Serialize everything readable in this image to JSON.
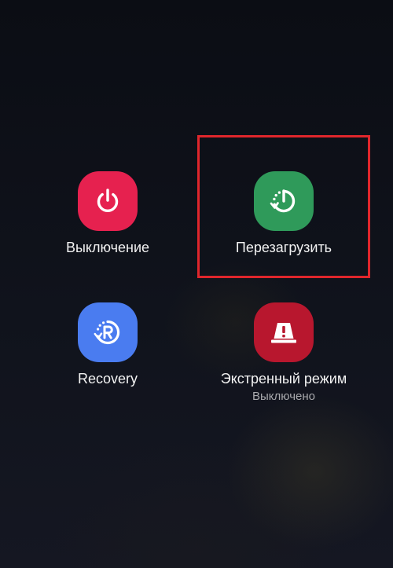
{
  "power_menu": {
    "options": [
      {
        "label": "Выключение",
        "icon": "power-icon",
        "color": "#e6214f"
      },
      {
        "label": "Перезагрузить",
        "icon": "restart-icon",
        "color": "#2f9a5a"
      },
      {
        "label": "Recovery",
        "icon": "recovery-icon",
        "color": "#4a7cf0"
      },
      {
        "label": "Экстренный режим",
        "sublabel": "Выключено",
        "icon": "emergency-icon",
        "color": "#b8172e"
      }
    ]
  },
  "highlight": {
    "color": "#e0262c",
    "target": "Перезагрузить"
  }
}
